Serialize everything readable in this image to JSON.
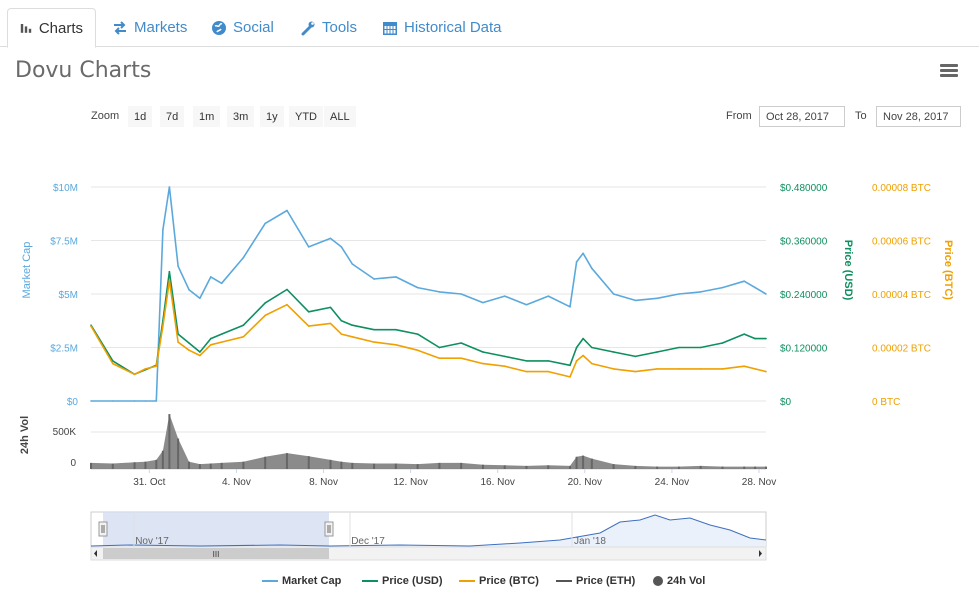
{
  "tabs": [
    {
      "label": "Charts",
      "icon": "bar-chart-icon"
    },
    {
      "label": "Markets",
      "icon": "exchange-arrows-icon"
    },
    {
      "label": "Social",
      "icon": "globe-icon"
    },
    {
      "label": "Tools",
      "icon": "wrench-icon"
    },
    {
      "label": "Historical Data",
      "icon": "calendar-icon"
    }
  ],
  "page": {
    "title": "Dovu Charts",
    "menu_icon": "hamburger-menu-icon"
  },
  "toolbar": {
    "zoom_label": "Zoom",
    "zoom_buttons": [
      "1d",
      "7d",
      "1m",
      "3m",
      "1y",
      "YTD",
      "ALL"
    ],
    "from_label": "From",
    "from_value": "Oct 28, 2017",
    "to_label": "To",
    "to_value": "Nov 28, 2017"
  },
  "colors": {
    "market_cap": "#5ba9dc",
    "price_usd": "#0e8f5f",
    "price_btc": "#f0a000",
    "price_eth": "#555555",
    "volume": "#777777",
    "navigator_fill": "#d4ddf0",
    "axis_mc": "#5ba9dc",
    "axis_usd": "#0e8f5f",
    "axis_btc": "#f0a000"
  },
  "chart_data": {
    "type": "line",
    "title": "",
    "x_ticks": [
      "31. Oct",
      "4. Nov",
      "8. Nov",
      "12. Nov",
      "16. Nov",
      "20. Nov",
      "24. Nov",
      "28. Nov"
    ],
    "x_range": [
      "2017-10-28",
      "2017-11-28"
    ],
    "y_axes": {
      "market_cap": {
        "label": "Market Cap",
        "ticks": [
          "$0",
          "$2.5M",
          "$5M",
          "$7.5M",
          "$10M"
        ],
        "range": [
          0,
          10000000
        ]
      },
      "price_usd": {
        "label": "Price (USD)",
        "ticks": [
          "$0",
          "$0.120000",
          "$0.240000",
          "$0.360000",
          "$0.480000"
        ],
        "range": [
          0,
          0.48
        ]
      },
      "price_btc": {
        "label": "Price (BTC)",
        "ticks": [
          "0 BTC",
          "0.00002 BTC",
          "0.00004 BTC",
          "0.00006 BTC",
          "0.00008 BTC"
        ],
        "range": [
          0,
          8e-05
        ]
      },
      "volume": {
        "label": "24h Vol",
        "ticks": [
          "0",
          "500K"
        ],
        "range": [
          0,
          1000000
        ]
      }
    },
    "x_days": [
      0,
      1,
      2,
      2.5,
      3,
      3.3,
      3.6,
      4,
      4.5,
      5,
      5.5,
      6,
      7,
      8,
      9,
      10,
      11,
      11.5,
      12,
      13,
      14,
      15,
      16,
      17,
      18,
      19,
      20,
      21,
      22,
      22.3,
      22.6,
      23,
      24,
      25,
      26,
      27,
      28,
      29,
      30,
      30.5,
      31
    ],
    "series": [
      {
        "name": "Market Cap",
        "axis": "market_cap",
        "values": [
          0,
          0,
          0,
          0,
          0,
          8000000,
          10000000,
          6300000,
          5200000,
          4800000,
          5800000,
          5500000,
          6700000,
          8300000,
          8900000,
          7200000,
          7600000,
          7200000,
          6400000,
          5700000,
          5800000,
          5300000,
          5100000,
          5000000,
          4600000,
          4900000,
          4500000,
          4900000,
          4400000,
          6500000,
          6900000,
          6200000,
          5000000,
          4700000,
          4800000,
          5000000,
          5100000,
          5300000,
          5600000,
          5300000,
          5000000
        ]
      },
      {
        "name": "Price (USD)",
        "axis": "price_usd",
        "values": [
          0.17,
          0.09,
          0.06,
          0.07,
          0.08,
          0.18,
          0.29,
          0.15,
          0.13,
          0.11,
          0.14,
          0.15,
          0.17,
          0.22,
          0.25,
          0.2,
          0.21,
          0.18,
          0.17,
          0.16,
          0.16,
          0.15,
          0.12,
          0.13,
          0.11,
          0.1,
          0.09,
          0.09,
          0.08,
          0.12,
          0.14,
          0.12,
          0.11,
          0.1,
          0.11,
          0.12,
          0.12,
          0.13,
          0.15,
          0.14,
          0.14
        ]
      },
      {
        "name": "Price (BTC)",
        "axis": "price_btc",
        "values": [
          2.8e-05,
          1.4e-05,
          1e-05,
          1.2e-05,
          1.3e-05,
          2.8e-05,
          4.5e-05,
          2.2e-05,
          1.9e-05,
          1.7e-05,
          2.1e-05,
          2.2e-05,
          2.4e-05,
          3.2e-05,
          3.6e-05,
          2.8e-05,
          2.9e-05,
          2.5e-05,
          2.4e-05,
          2.2e-05,
          2.1e-05,
          1.9e-05,
          1.6e-05,
          1.6e-05,
          1.4e-05,
          1.3e-05,
          1.1e-05,
          1.1e-05,
          9e-06,
          1.5e-05,
          1.7e-05,
          1.4e-05,
          1.2e-05,
          1.1e-05,
          1.2e-05,
          1.2e-05,
          1.2e-05,
          1.2e-05,
          1.3e-05,
          1.2e-05,
          1.1e-05
        ]
      },
      {
        "name": "24h Vol",
        "axis": "volume",
        "values": [
          100000,
          90000,
          110000,
          120000,
          150000,
          300000,
          900000,
          500000,
          120000,
          80000,
          90000,
          100000,
          120000,
          200000,
          260000,
          210000,
          150000,
          120000,
          100000,
          90000,
          90000,
          80000,
          100000,
          100000,
          70000,
          60000,
          50000,
          60000,
          50000,
          200000,
          220000,
          170000,
          80000,
          50000,
          40000,
          40000,
          50000,
          40000,
          40000,
          40000,
          40000
        ]
      }
    ],
    "legend": [
      "Market Cap",
      "Price (USD)",
      "Price (BTC)",
      "Price (ETH)",
      "24h Vol"
    ],
    "navigator": {
      "ticks": [
        "Nov '17",
        "Dec '17",
        "Jan '18"
      ],
      "scrollbar_grip": "III"
    }
  }
}
